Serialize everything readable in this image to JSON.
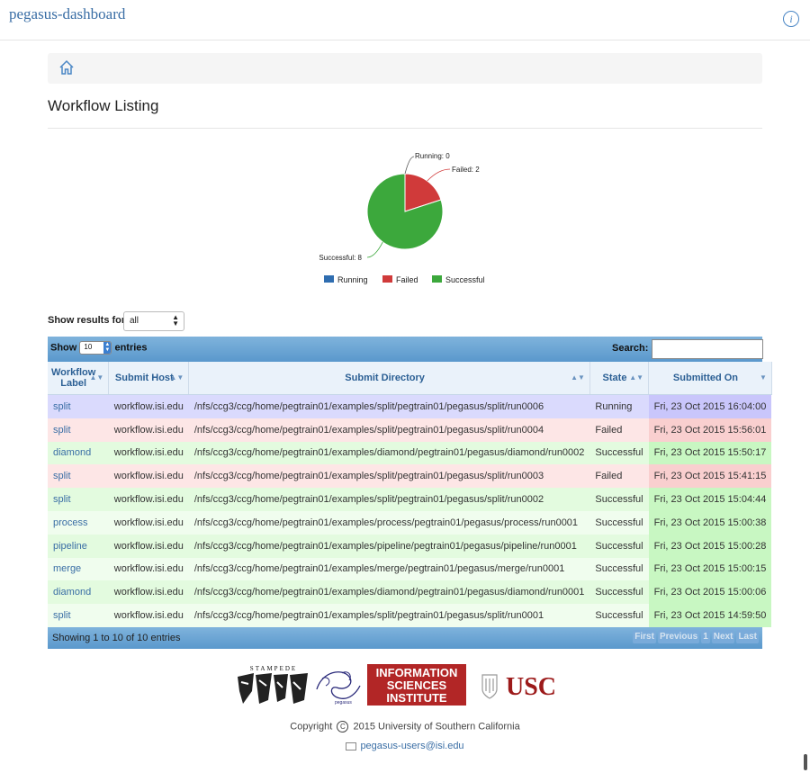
{
  "app": {
    "brand": "pegasus-dashboard"
  },
  "page": {
    "title": "Workflow Listing"
  },
  "chart_data": {
    "type": "pie",
    "categories": [
      "Running",
      "Failed",
      "Successful"
    ],
    "values": [
      0,
      2,
      8
    ],
    "slice_labels": [
      "Running: 0",
      "Failed: 2",
      "Successful: 8"
    ],
    "colors": [
      "#2f6db0",
      "#d03a3a",
      "#3ca83c"
    ],
    "legend": {
      "placement": "bottom",
      "entries": [
        "Running",
        "Failed",
        "Successful"
      ]
    }
  },
  "filter": {
    "label": "Show results for",
    "value": "all"
  },
  "table": {
    "show_label": "Show",
    "length_value": "10",
    "entries_label": "entries",
    "search_label": "Search:",
    "search_value": "",
    "columns": [
      "Workflow Label",
      "Submit Host",
      "Submit Directory",
      "State",
      "Submitted On"
    ],
    "rows": [
      {
        "label": "split",
        "host": "workflow.isi.edu",
        "dir": "/nfs/ccg3/ccg/home/pegtrain01/examples/split/pegtrain01/pegasus/split/run0006",
        "state": "Running",
        "date": "Fri, 23 Oct 2015 16:04:00"
      },
      {
        "label": "split",
        "host": "workflow.isi.edu",
        "dir": "/nfs/ccg3/ccg/home/pegtrain01/examples/split/pegtrain01/pegasus/split/run0004",
        "state": "Failed",
        "date": "Fri, 23 Oct 2015 15:56:01"
      },
      {
        "label": "diamond",
        "host": "workflow.isi.edu",
        "dir": "/nfs/ccg3/ccg/home/pegtrain01/examples/diamond/pegtrain01/pegasus/diamond/run0002",
        "state": "Successful",
        "date": "Fri, 23 Oct 2015 15:50:17"
      },
      {
        "label": "split",
        "host": "workflow.isi.edu",
        "dir": "/nfs/ccg3/ccg/home/pegtrain01/examples/split/pegtrain01/pegasus/split/run0003",
        "state": "Failed",
        "date": "Fri, 23 Oct 2015 15:41:15"
      },
      {
        "label": "split",
        "host": "workflow.isi.edu",
        "dir": "/nfs/ccg3/ccg/home/pegtrain01/examples/split/pegtrain01/pegasus/split/run0002",
        "state": "Successful",
        "date": "Fri, 23 Oct 2015 15:04:44"
      },
      {
        "label": "process",
        "host": "workflow.isi.edu",
        "dir": "/nfs/ccg3/ccg/home/pegtrain01/examples/process/pegtrain01/pegasus/process/run0001",
        "state": "Successful",
        "date": "Fri, 23 Oct 2015 15:00:38"
      },
      {
        "label": "pipeline",
        "host": "workflow.isi.edu",
        "dir": "/nfs/ccg3/ccg/home/pegtrain01/examples/pipeline/pegtrain01/pegasus/pipeline/run0001",
        "state": "Successful",
        "date": "Fri, 23 Oct 2015 15:00:28"
      },
      {
        "label": "merge",
        "host": "workflow.isi.edu",
        "dir": "/nfs/ccg3/ccg/home/pegtrain01/examples/merge/pegtrain01/pegasus/merge/run0001",
        "state": "Successful",
        "date": "Fri, 23 Oct 2015 15:00:15"
      },
      {
        "label": "diamond",
        "host": "workflow.isi.edu",
        "dir": "/nfs/ccg3/ccg/home/pegtrain01/examples/diamond/pegtrain01/pegasus/diamond/run0001",
        "state": "Successful",
        "date": "Fri, 23 Oct 2015 15:00:06"
      },
      {
        "label": "split",
        "host": "workflow.isi.edu",
        "dir": "/nfs/ccg3/ccg/home/pegtrain01/examples/split/pegtrain01/pegasus/split/run0001",
        "state": "Successful",
        "date": "Fri, 23 Oct 2015 14:59:50"
      }
    ],
    "info": "Showing 1 to 10 of 10 entries",
    "pager": [
      "First",
      "Previous",
      "1",
      "Next",
      "Last"
    ]
  },
  "footer": {
    "logos": {
      "stampede": "STAMPEDE",
      "pegasus": "pegasus",
      "isi_line1": "INFORMATION",
      "isi_line2": "SCIENCES",
      "isi_line3": "INSTITUTE",
      "usc": "USC"
    },
    "copyright_prefix": "Copyright",
    "copyright_suffix": "2015 University of Southern California",
    "email": "pegasus-users@isi.edu"
  },
  "icons": {
    "info": "info-icon",
    "home": "home-icon",
    "copyright": "copyright-icon",
    "mail": "mail-icon"
  }
}
